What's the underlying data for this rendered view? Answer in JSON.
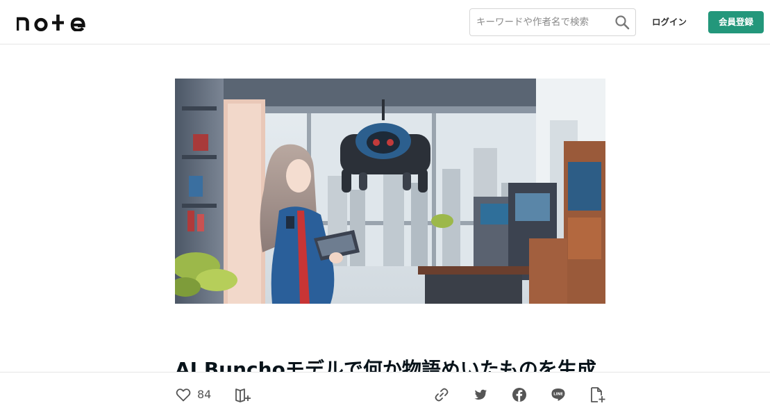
{
  "header": {
    "logo_text": "note",
    "search": {
      "placeholder": "キーワードや作者名で検索",
      "value": ""
    },
    "login_label": "ログイン",
    "signup_label": "会員登録",
    "accent_color": "#2cb696"
  },
  "article": {
    "hero_image": "anime illustration: long-haired girl in blue jacket holding a tablet, hovering robot drone, window with city view",
    "title": "AI Bunchoモデルで何か物語めいたものを生成"
  },
  "bottom_bar": {
    "like_icon": "heart-icon",
    "like_count": "84",
    "magazine_icon": "magazine-add-icon",
    "share_icons": [
      "link-icon",
      "twitter-icon",
      "facebook-icon",
      "line-icon",
      "embed-icon"
    ],
    "line_label": "LINE"
  }
}
